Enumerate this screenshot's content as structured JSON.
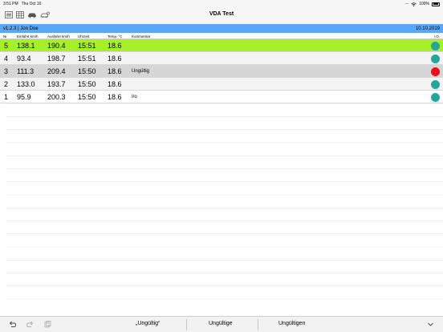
{
  "status": {
    "time": "3:51 PM",
    "date": "Thu Oct 10",
    "battery": "100%"
  },
  "nav": {
    "title": "VDA Test"
  },
  "info": {
    "left": "v1.2.3 | Jon Doe",
    "right": "10.10.2019"
  },
  "columns": {
    "nr": "Nr",
    "entry": "Einfahrt km/h",
    "exit": "Ausfahrt km/h",
    "time": "Uhrzeit",
    "temp": "Temp. °C",
    "comment": "Kommentar",
    "io": "i.O."
  },
  "rows": [
    {
      "nr": "5",
      "entry": "138.1",
      "exit": "190.4",
      "time": "15:51",
      "temp": "18.6",
      "comment": "",
      "bg": "#a6f02a",
      "status": "#26a69a"
    },
    {
      "nr": "4",
      "entry": "93.4",
      "exit": "198.7",
      "time": "15:51",
      "temp": "18.6",
      "comment": "",
      "bg": "#f3f3f3",
      "status": "#26a69a"
    },
    {
      "nr": "3",
      "entry": "111.3",
      "exit": "209.4",
      "time": "15:50",
      "temp": "18.6",
      "comment": "Ungültig",
      "bg": "#d6d6d6",
      "status": "#e8101a"
    },
    {
      "nr": "2",
      "entry": "133.0",
      "exit": "193.7",
      "time": "15:50",
      "temp": "18.6",
      "comment": "",
      "bg": "#f3f3f3",
      "status": "#26a69a"
    },
    {
      "nr": "1",
      "entry": "95.9",
      "exit": "200.3",
      "time": "15:50",
      "temp": "18.6",
      "comment": "I/o",
      "bg": "#ffffff",
      "status": "#26a69a"
    }
  ],
  "toolbar": {
    "suggest1": "„Ungültig“",
    "suggest2": "Ungültige",
    "suggest3": "Ungültigen"
  },
  "icons": [
    "list-icon",
    "grid-icon",
    "car-icon",
    "car-settings-icon",
    "undo-icon",
    "redo-icon",
    "clipboard-icon",
    "chevron-down-icon",
    "wifi-icon"
  ]
}
